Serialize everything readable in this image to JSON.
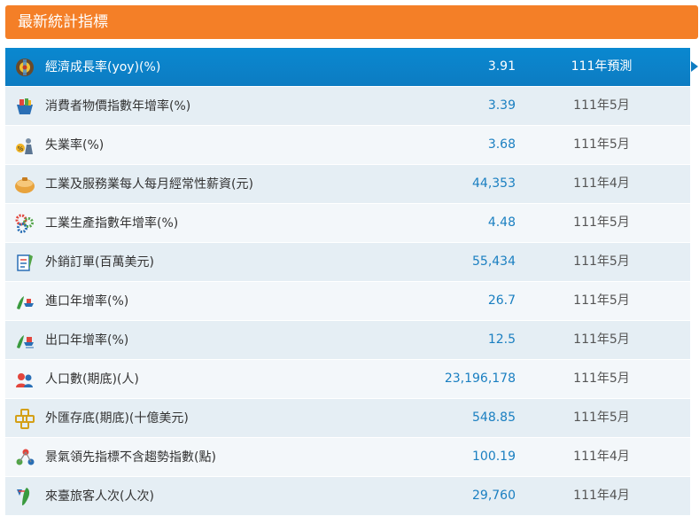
{
  "panel": {
    "title": "最新統計指標"
  },
  "indicators": [
    {
      "icon": "economy-growth-icon",
      "name": "經濟成長率(yoy)(%)",
      "value": "3.91",
      "period": "111年預測",
      "active": true
    },
    {
      "icon": "shopping-basket-icon",
      "name": "消費者物價指數年增率(%)",
      "value": "3.39",
      "period": "111年5月"
    },
    {
      "icon": "unemployment-icon",
      "name": "失業率(%)",
      "value": "3.68",
      "period": "111年5月"
    },
    {
      "icon": "wallet-icon",
      "name": "工業及服務業每人每月經常性薪資(元)",
      "value": "44,353",
      "period": "111年4月"
    },
    {
      "icon": "gears-icon",
      "name": "工業生產指數年增率(%)",
      "value": "4.48",
      "period": "111年5月"
    },
    {
      "icon": "orders-icon",
      "name": "外銷訂單(百萬美元)",
      "value": "55,434",
      "period": "111年5月"
    },
    {
      "icon": "import-ship-icon",
      "name": "進口年增率(%)",
      "value": "26.7",
      "period": "111年5月"
    },
    {
      "icon": "export-ship-icon",
      "name": "出口年增率(%)",
      "value": "12.5",
      "period": "111年5月"
    },
    {
      "icon": "population-icon",
      "name": "人口數(期底)(人)",
      "value": "23,196,178",
      "period": "111年5月"
    },
    {
      "icon": "fx-reserve-icon",
      "name": "外匯存底(期底)(十億美元)",
      "value": "548.85",
      "period": "111年5月"
    },
    {
      "icon": "leading-indicator-icon",
      "name": "景氣領先指標不含趨勢指數(點)",
      "value": "100.19",
      "period": "111年4月"
    },
    {
      "icon": "visitors-taiwan-icon",
      "name": "來臺旅客人次(人次)",
      "value": "29,760",
      "period": "111年4月"
    }
  ]
}
